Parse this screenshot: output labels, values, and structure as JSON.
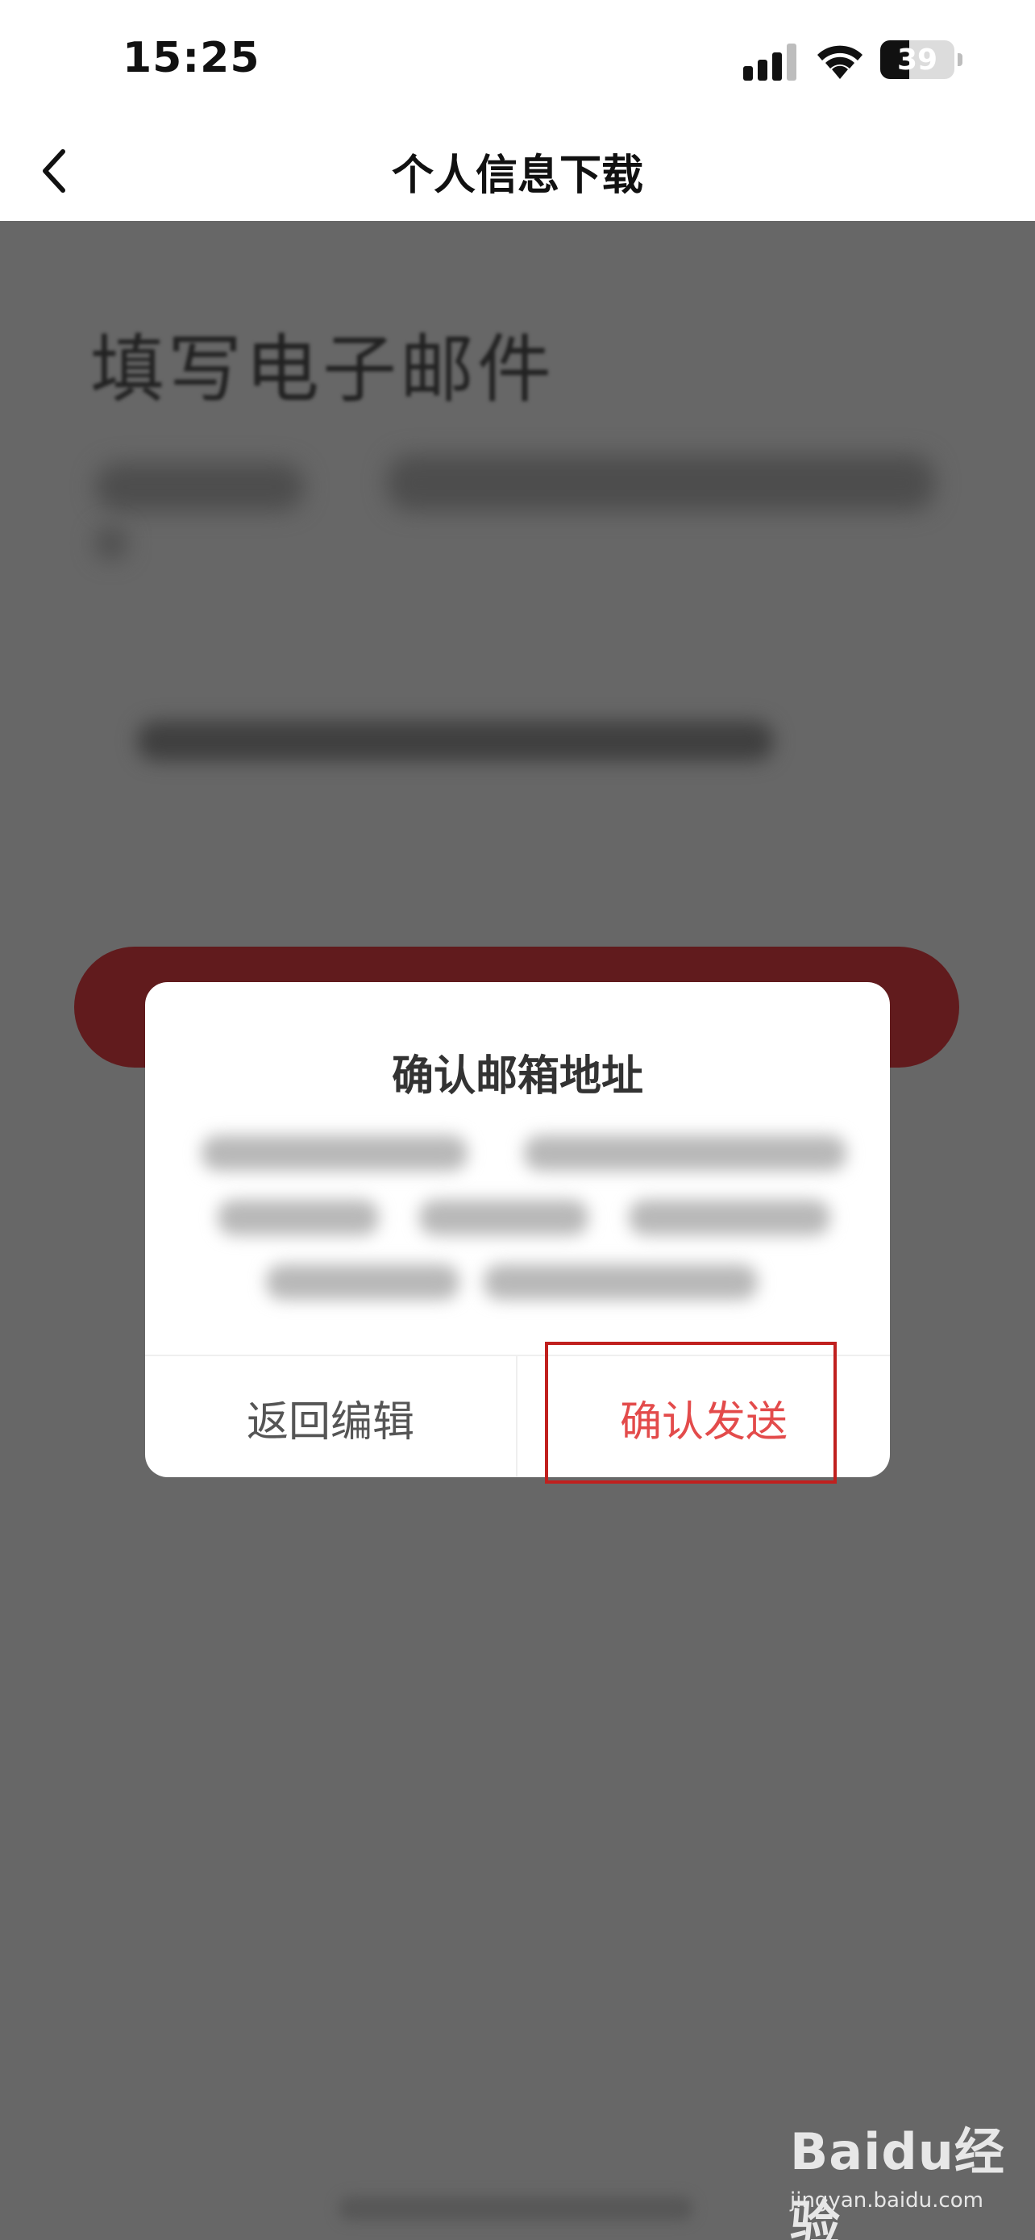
{
  "status_bar": {
    "time": "15:25",
    "battery_level": "39",
    "icons": [
      "signal-icon",
      "wifi-icon",
      "battery-icon"
    ]
  },
  "nav": {
    "title": "个人信息下载",
    "back_icon": "chevron-left-icon"
  },
  "background": {
    "heading": "填写电子邮件",
    "button_color": "#611b1d"
  },
  "dialog": {
    "title": "确认邮箱地址",
    "cancel_label": "返回编辑",
    "confirm_label": "确认发送",
    "confirm_color": "#e34b4b",
    "highlight_color": "#c0201e"
  },
  "watermark": {
    "logo": "Baidu经验",
    "site": "jingyan.baidu.com"
  }
}
